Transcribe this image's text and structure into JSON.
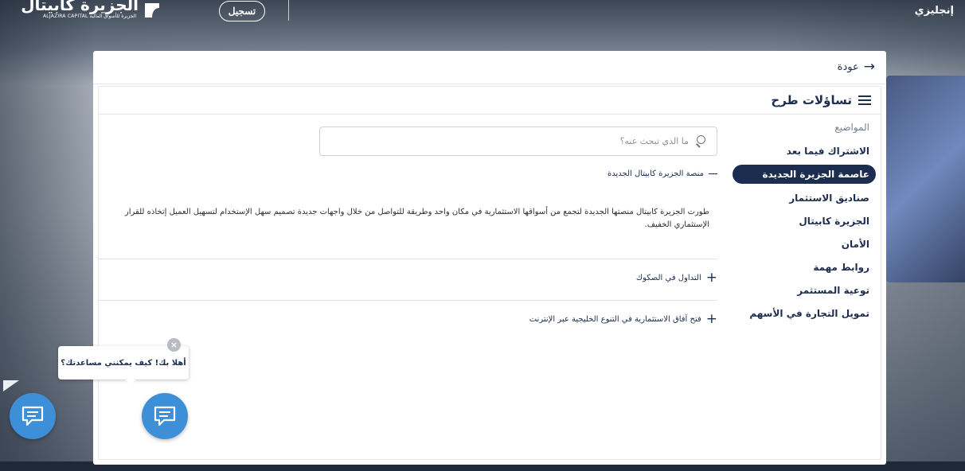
{
  "header": {
    "logo_ar": "الجزيرة كابيتال",
    "logo_en": "ALJAZIRA CAPITAL الجزيرة للأسواق المالية",
    "register_label": "تسجيل",
    "language_label": "إنجليزي"
  },
  "panel": {
    "back_label": "عودة",
    "faq_title": "تساؤلات طرح"
  },
  "topics": {
    "title": "المواضيع",
    "items": [
      {
        "label": "الاشتراك فيما بعد",
        "active": false
      },
      {
        "label": "عاصمة الجزيرة الجديدة",
        "active": true
      },
      {
        "label": "صناديق الاستثمار",
        "active": false
      },
      {
        "label": "الجزيرة كابيتال",
        "active": false
      },
      {
        "label": "الأمان",
        "active": false
      },
      {
        "label": "روابط مهمة",
        "active": false
      },
      {
        "label": "توعية المستثمر",
        "active": false
      },
      {
        "label": "تمويل التجارة في الأسهم",
        "active": false
      }
    ]
  },
  "search": {
    "placeholder": "ما الذي تبحث عنه؟",
    "value": ""
  },
  "faq": {
    "open_question": "منصة الجزيرة كابيتال الجديدة",
    "open_answer": "طورت الجزيرة كابيتال منصتها الجديدة لتجمع من أسواقها الاستثمارية في مكان واحد وطريقة للتواصل من خلال واجهات جديدة تصميم سهل الإستخدام لتسهيل العميل إتخاذه للقرار الإستثماري الخفيف.",
    "questions": [
      "التداول في الصكوك",
      "فتح آفاق الاستثمارية في التنوع الخليجية عبر الإنترنت"
    ]
  },
  "chat": {
    "greeting": "أهلا بك! كيف يمكنني مساعدتك؟",
    "close_symbol": "×"
  },
  "colors": {
    "navy": "#1d2d50",
    "chat_blue": "#3d8fd8"
  }
}
